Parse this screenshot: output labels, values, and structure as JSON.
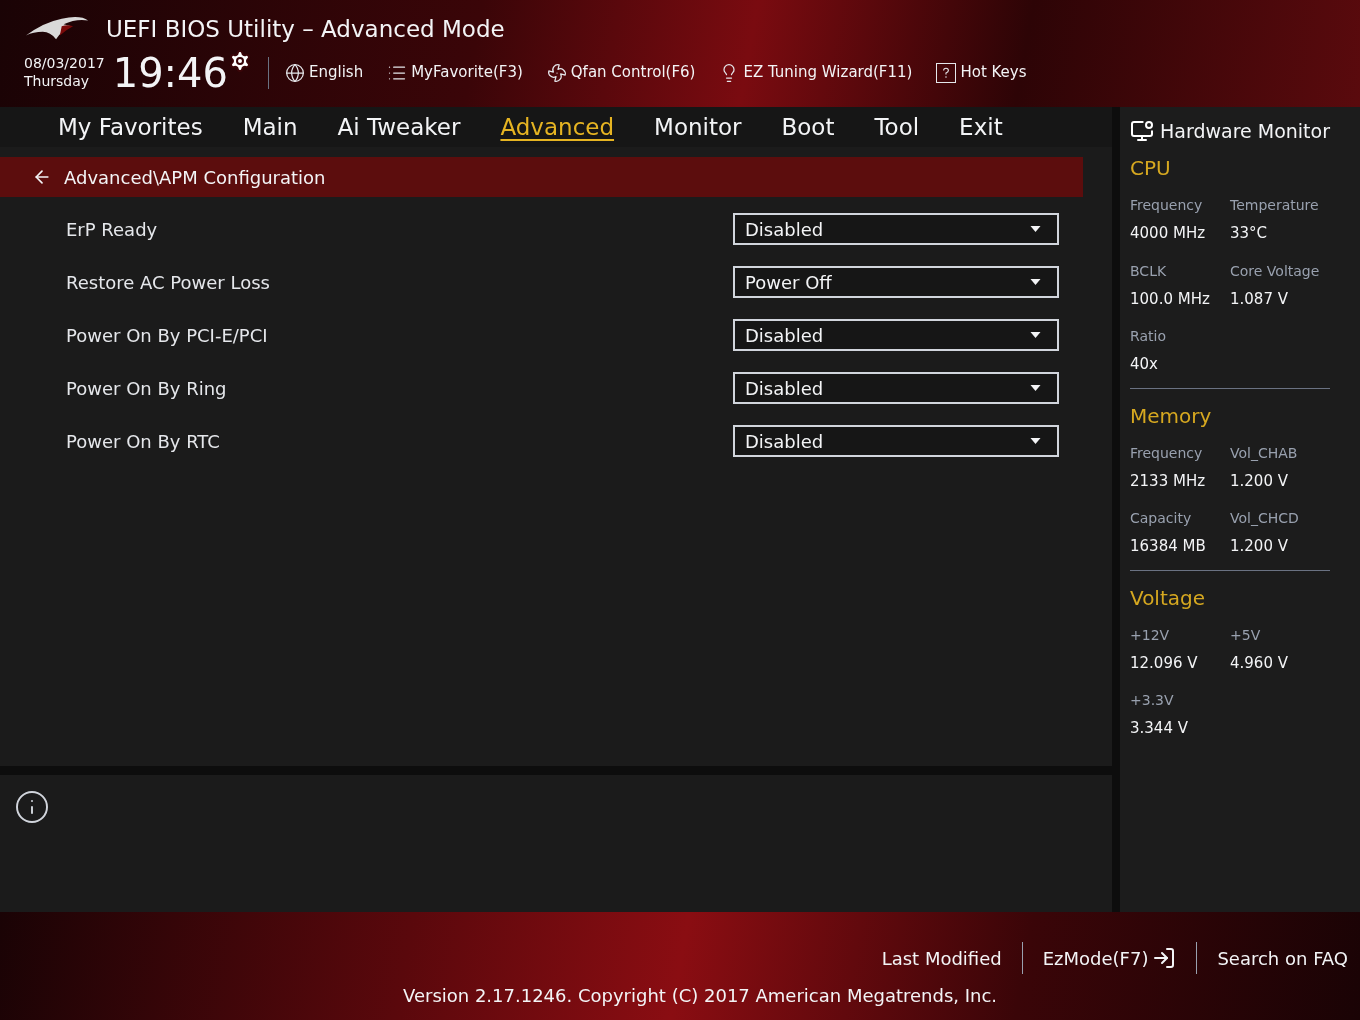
{
  "header": {
    "title": "UEFI BIOS Utility – Advanced Mode",
    "date": "08/03/2017",
    "day": "Thursday",
    "time": "19:46",
    "toolbar": [
      {
        "kind": "globe",
        "label": "English"
      },
      {
        "kind": "list",
        "label": "MyFavorite(F3)"
      },
      {
        "kind": "fan",
        "label": "Qfan Control(F6)"
      },
      {
        "kind": "bulb",
        "label": "EZ Tuning Wizard(F11)"
      },
      {
        "kind": "help",
        "label": "Hot Keys"
      }
    ]
  },
  "tabs": [
    {
      "label": "My Favorites",
      "selected": false
    },
    {
      "label": "Main",
      "selected": false
    },
    {
      "label": "Ai Tweaker",
      "selected": false
    },
    {
      "label": "Advanced",
      "selected": true
    },
    {
      "label": "Monitor",
      "selected": false
    },
    {
      "label": "Boot",
      "selected": false
    },
    {
      "label": "Tool",
      "selected": false
    },
    {
      "label": "Exit",
      "selected": false
    }
  ],
  "breadcrumb": "Advanced\\APM Configuration",
  "settings": [
    {
      "label": "ErP Ready",
      "value": "Disabled"
    },
    {
      "label": "Restore AC Power Loss",
      "value": "Power Off"
    },
    {
      "label": "Power On By PCI-E/PCI",
      "value": "Disabled"
    },
    {
      "label": "Power On By Ring",
      "value": "Disabled"
    },
    {
      "label": "Power On By RTC",
      "value": "Disabled"
    }
  ],
  "hardware_monitor": {
    "title": "Hardware Monitor",
    "sections": [
      {
        "title": "CPU",
        "items": [
          {
            "label": "Frequency",
            "value": "4000 MHz"
          },
          {
            "label": "Temperature",
            "value": "33°C"
          },
          {
            "label": "BCLK",
            "value": "100.0 MHz"
          },
          {
            "label": "Core Voltage",
            "value": "1.087 V"
          },
          {
            "label": "Ratio",
            "value": "40x"
          }
        ]
      },
      {
        "title": "Memory",
        "items": [
          {
            "label": "Frequency",
            "value": "2133 MHz"
          },
          {
            "label": "Vol_CHAB",
            "value": "1.200 V"
          },
          {
            "label": "Capacity",
            "value": "16384 MB"
          },
          {
            "label": "Vol_CHCD",
            "value": "1.200 V"
          }
        ]
      },
      {
        "title": "Voltage",
        "items": [
          {
            "label": "+12V",
            "value": "12.096 V"
          },
          {
            "label": "+5V",
            "value": "4.960 V"
          },
          {
            "label": "+3.3V",
            "value": "3.344 V"
          }
        ]
      }
    ]
  },
  "footer": {
    "links": [
      {
        "kind": "text",
        "label": "Last Modified"
      },
      {
        "kind": "exit",
        "label": "EzMode(F7)"
      },
      {
        "kind": "text",
        "label": "Search on FAQ"
      }
    ],
    "version": "Version 2.17.1246. Copyright (C) 2017 American Megatrends, Inc."
  }
}
